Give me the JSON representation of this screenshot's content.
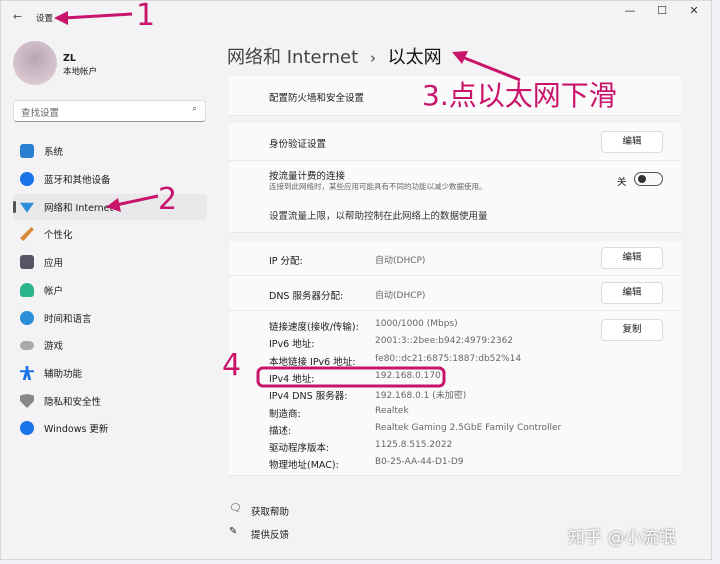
{
  "titlebar": {
    "back": "←",
    "title": "设置",
    "minimize": "—",
    "maximize": "☐",
    "close": "✕"
  },
  "user": {
    "name": "ZL",
    "type": "本地帐户"
  },
  "search": {
    "placeholder": "查找设置"
  },
  "nav": [
    {
      "label": "系统",
      "color": "#2b7fd0"
    },
    {
      "label": "蓝牙和其他设备",
      "color": "#1a73e8"
    },
    {
      "label": "网络和 Internet",
      "color": "#2a8fd6"
    },
    {
      "label": "个性化",
      "color": "#d98b3a"
    },
    {
      "label": "应用",
      "color": "#556"
    },
    {
      "label": "帐户",
      "color": "#2bb38a"
    },
    {
      "label": "时间和语言",
      "color": "#2a8fd6"
    },
    {
      "label": "游戏",
      "color": "#999"
    },
    {
      "label": "辅助功能",
      "color": "#1a73e8"
    },
    {
      "label": "隐私和安全性",
      "color": "#888"
    },
    {
      "label": "Windows 更新",
      "color": "#1a73e8"
    }
  ],
  "breadcrumb": {
    "parent": "网络和 Internet",
    "sep": "›",
    "current": "以太网"
  },
  "firewall_link": "配置防火墙和安全设置",
  "auth": {
    "label": "身份验证设置",
    "button": "编辑"
  },
  "metered": {
    "title": "按流量计费的连接",
    "desc": "连接到此网络时，某些应用可能具有不同的功能以减少数据使用。",
    "state": "关",
    "on": false,
    "limit_link": "设置流量上限，以帮助控制在此网络上的数据使用量"
  },
  "ip_assign": {
    "label": "IP 分配:",
    "value": "自动(DHCP)",
    "button": "编辑"
  },
  "dns_assign": {
    "label": "DNS 服务器分配:",
    "value": "自动(DHCP)",
    "button": "编辑"
  },
  "details": {
    "button": "复制",
    "rows": [
      {
        "label": "链接速度(接收/传输):",
        "value": "1000/1000 (Mbps)"
      },
      {
        "label": "IPv6 地址:",
        "value": "2001:3::2bee:b942:4979:2362"
      },
      {
        "label": "本地链接 IPv6 地址:",
        "value": "fe80::dc21:6875:1887:db52%14"
      },
      {
        "label": "IPv4 地址:",
        "value": "192.168.0.170"
      },
      {
        "label": "IPv4 DNS 服务器:",
        "value": "192.168.0.1 (未加密)"
      },
      {
        "label": "制造商:",
        "value": "Realtek"
      },
      {
        "label": "描述:",
        "value": "Realtek Gaming 2.5GbE Family Controller"
      },
      {
        "label": "驱动程序版本:",
        "value": "1125.8.515.2022"
      },
      {
        "label": "物理地址(MAC):",
        "value": "B0-25-AA-44-D1-D9"
      }
    ]
  },
  "help": {
    "get_help": "获取帮助",
    "feedback": "提供反馈"
  },
  "annotations": {
    "n1": "1",
    "n2": "2",
    "n3": "3.点以太网下滑",
    "n4": "4",
    "color": "#c8146b"
  },
  "watermark": "知乎 @小流氓"
}
